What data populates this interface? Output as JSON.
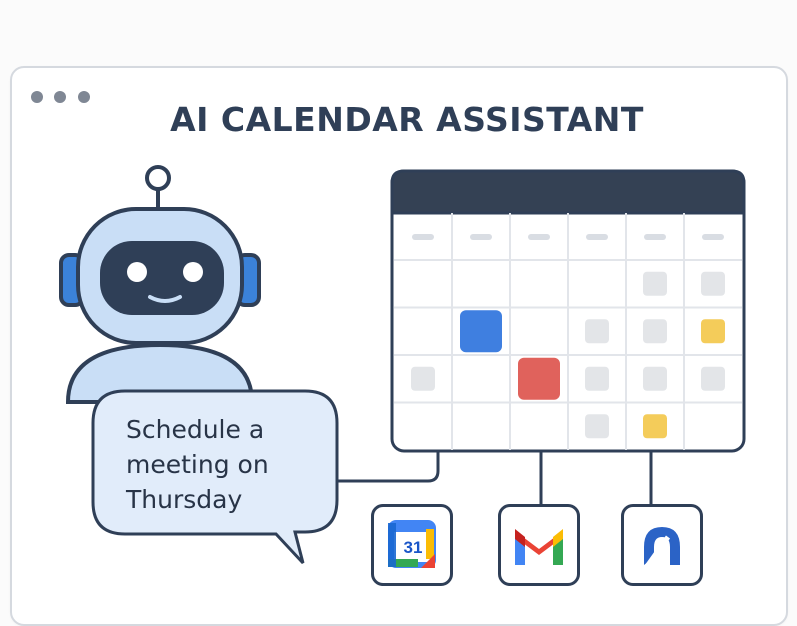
{
  "window": {
    "title": "AI CALENDAR ASSISTANT",
    "controls": [
      "dot-1",
      "dot-2",
      "dot-3"
    ]
  },
  "assistant": {
    "avatar_icon": "robot-icon",
    "message": "Schedule a meeting on Thursday"
  },
  "calendar": {
    "columns": 6,
    "rows": 4,
    "header_color": "#344154",
    "events": [
      {
        "row": 1,
        "col": 1,
        "color": "#3f7fe0",
        "kind": "highlight"
      },
      {
        "row": 2,
        "col": 2,
        "color": "#e0625c",
        "kind": "highlight"
      },
      {
        "row": 1,
        "col": 5,
        "color": "#f4cc5a",
        "kind": "event"
      },
      {
        "row": 3,
        "col": 4,
        "color": "#f4cc5a",
        "kind": "event"
      }
    ]
  },
  "integrations": [
    {
      "name": "Google Calendar",
      "icon": "google-calendar-icon",
      "label": "31"
    },
    {
      "name": "Gmail",
      "icon": "gmail-icon"
    },
    {
      "name": "Arc",
      "icon": "arc-app-icon"
    }
  ],
  "colors": {
    "outline": "#2f3f57",
    "robot_fill": "#c9def6",
    "robot_ear": "#3b82d9",
    "bubble_fill": "#e1ecfa"
  }
}
